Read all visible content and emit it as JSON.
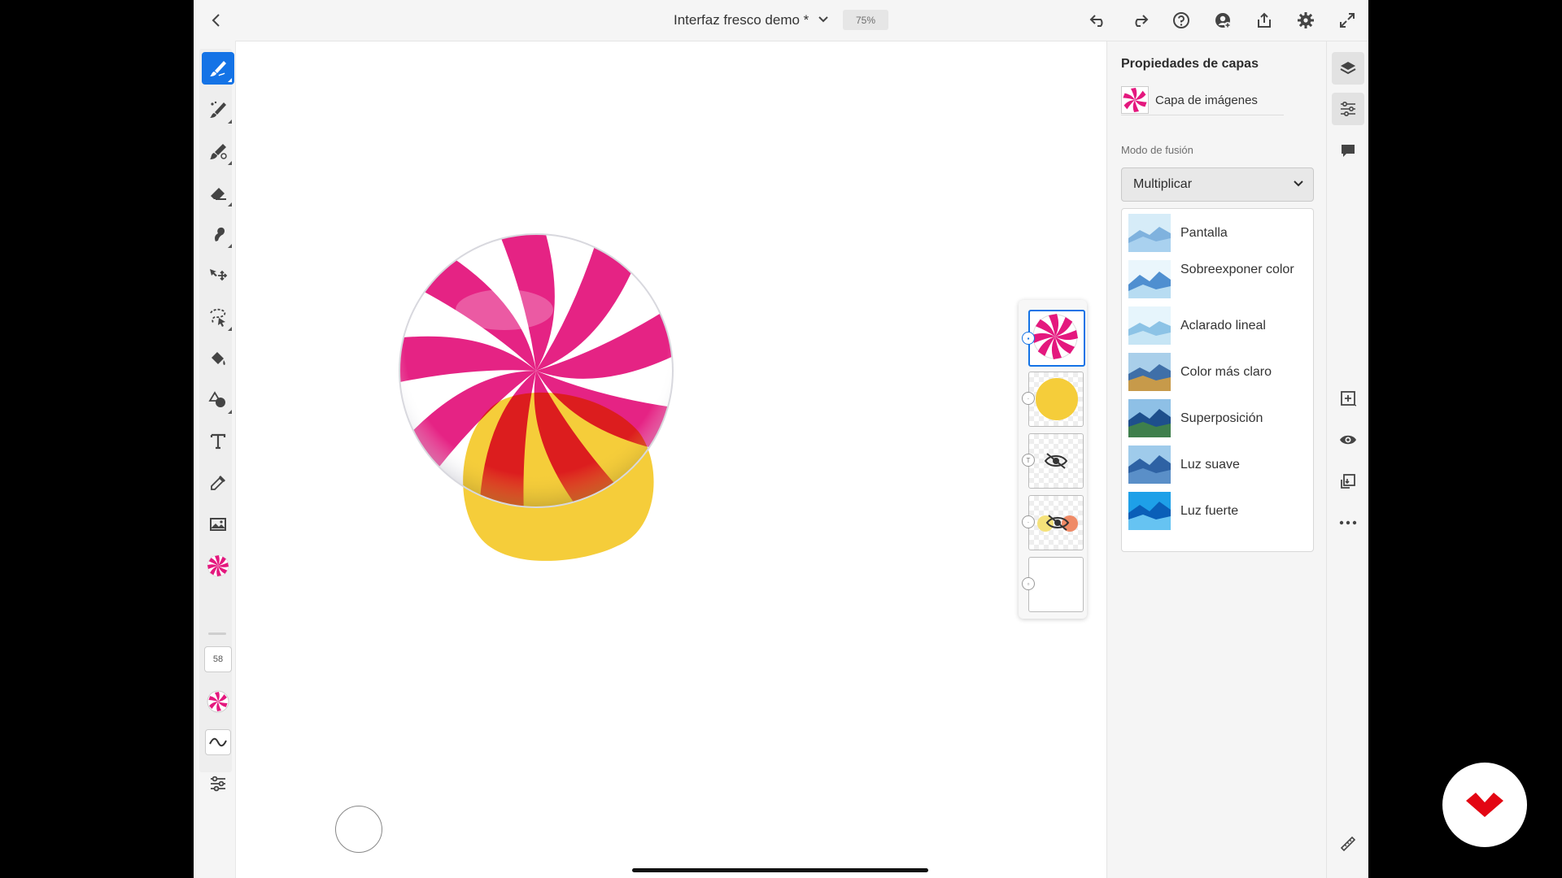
{
  "header": {
    "doc_title": "Interfaz fresco demo *",
    "zoom": "75%"
  },
  "toolbar": {
    "tools": [
      "live-brush",
      "pixel-brush",
      "vector-brush",
      "eraser",
      "smudge",
      "move",
      "selection",
      "fill",
      "shapes",
      "type",
      "eyedropper",
      "place-image"
    ],
    "brush_size": "58"
  },
  "properties": {
    "title": "Propiedades de capas",
    "layer_name": "Capa de imágenes",
    "blend_label": "Modo de fusión",
    "blend_value": "Multiplicar",
    "blend_options": [
      {
        "label": "Pantalla"
      },
      {
        "label": "Sobreexponer color"
      },
      {
        "label": "Aclarado lineal"
      },
      {
        "label": "Color más claro"
      },
      {
        "label": "Superposición"
      },
      {
        "label": "Luz suave"
      },
      {
        "label": "Luz fuerte"
      }
    ]
  },
  "colors": {
    "accent": "#1473e6",
    "candy_pink": "#e4187e",
    "candy_red": "#e6232b",
    "blob_yellow": "#f5cd3a",
    "brand_red": "#e30613"
  }
}
